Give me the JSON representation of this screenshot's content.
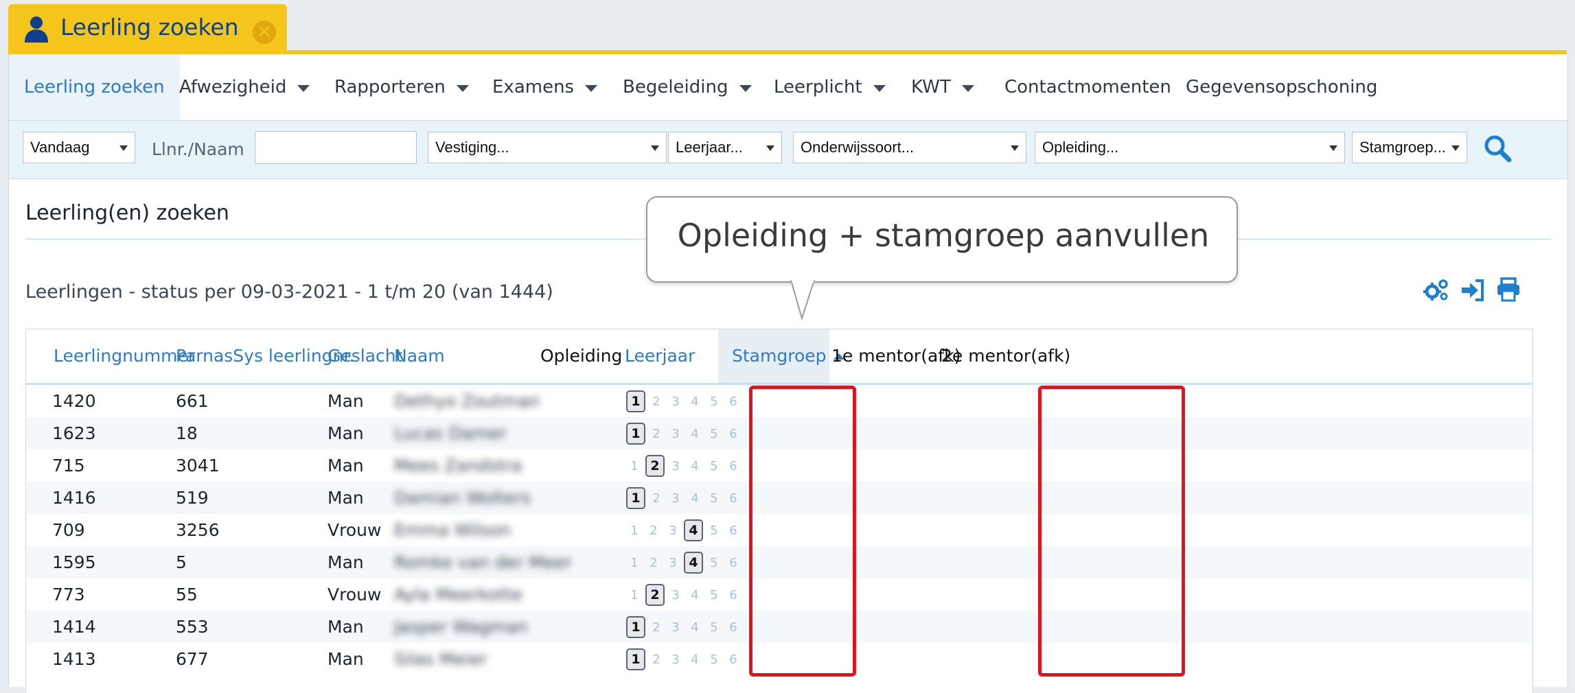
{
  "tab": {
    "label": "Leerling zoeken",
    "icon": "user-icon",
    "close_icon": "close-icon"
  },
  "menu": [
    {
      "label": "Leerling zoeken",
      "active": true,
      "dropdown": false
    },
    {
      "label": "Afwezigheid",
      "dropdown": true
    },
    {
      "label": "Rapporteren",
      "dropdown": true
    },
    {
      "label": "Examens",
      "dropdown": true
    },
    {
      "label": "Begeleiding",
      "dropdown": true
    },
    {
      "label": "Leerplicht",
      "dropdown": true
    },
    {
      "label": "KWT",
      "dropdown": true
    },
    {
      "label": "Contactmomenten",
      "dropdown": false
    },
    {
      "label": "Gegevensopschoning",
      "dropdown": false
    }
  ],
  "filters": {
    "date": "Vandaag",
    "search_label": "Llnr./Naam",
    "search_value": "",
    "vestiging": "Vestiging...",
    "leerjaar": "Leerjaar...",
    "onderwijssoort": "Onderwijssoort...",
    "opleiding": "Opleiding...",
    "stamgroep": "Stamgroep..."
  },
  "section_title": "Leerling(en) zoeken",
  "status_line": "Leerlingen - status per 09-03-2021 - 1 t/m 20 (van 1444)",
  "callout": "Opleiding + stamgroep aanvullen",
  "table": {
    "headers": [
      "Leerlingnummer",
      "ParnasSys leerlingnr.",
      "Geslacht",
      "Naam",
      "Opleiding",
      "Leerjaar",
      "Stamgroep",
      "1e mentor(afk)",
      "2e mentor(afk)"
    ],
    "year_options": [
      "1",
      "2",
      "3",
      "4",
      "5",
      "6"
    ],
    "rows": [
      {
        "nr": "1420",
        "parnassys": "661",
        "geslacht": "Man",
        "naam": "Dethyo Zoutman",
        "leerjaar": 1
      },
      {
        "nr": "1623",
        "parnassys": "18",
        "geslacht": "Man",
        "naam": "Lucas Damer",
        "leerjaar": 1
      },
      {
        "nr": "715",
        "parnassys": "3041",
        "geslacht": "Man",
        "naam": "Mees Zandstra",
        "leerjaar": 2
      },
      {
        "nr": "1416",
        "parnassys": "519",
        "geslacht": "Man",
        "naam": "Damian Wolters",
        "leerjaar": 1
      },
      {
        "nr": "709",
        "parnassys": "3256",
        "geslacht": "Vrouw",
        "naam": "Emma Wilson",
        "leerjaar": 4
      },
      {
        "nr": "1595",
        "parnassys": "5",
        "geslacht": "Man",
        "naam": "Romke van der Meer",
        "leerjaar": 4
      },
      {
        "nr": "773",
        "parnassys": "55",
        "geslacht": "Vrouw",
        "naam": "Ayla Meerkotte",
        "leerjaar": 2
      },
      {
        "nr": "1414",
        "parnassys": "553",
        "geslacht": "Man",
        "naam": "Jasper Wagman",
        "leerjaar": 1
      },
      {
        "nr": "1413",
        "parnassys": "677",
        "geslacht": "Man",
        "naam": "Silas Meier",
        "leerjaar": 1
      }
    ]
  },
  "colors": {
    "accent_yellow": "#f4c51a",
    "link_blue": "#2d7bc4",
    "highlight_red": "#e0141e"
  }
}
